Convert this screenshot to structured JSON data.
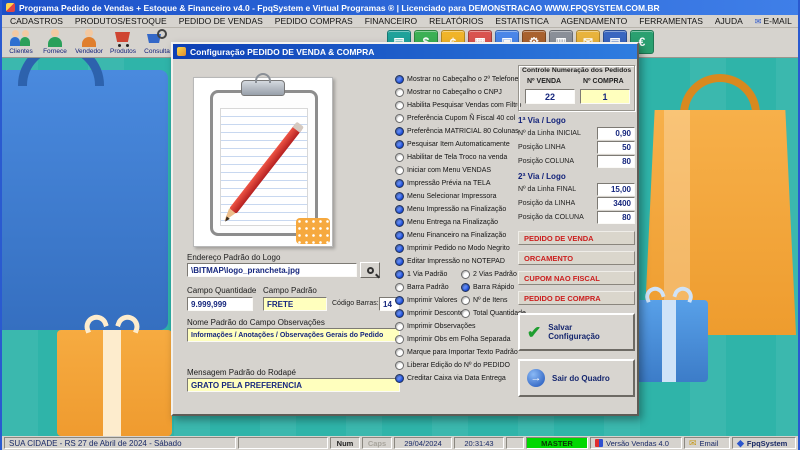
{
  "colors": {
    "titlebar": "#2160d4",
    "teal_background": "#2fb4a9",
    "accent_red": "#cc1f1f",
    "selected_blue": "#1645cf",
    "field_yellow": "#ffffbe",
    "status_green": "#00d800",
    "bag_orange": "#f5a93c",
    "bag_blue": "#3e7fd0"
  },
  "icons": {
    "email_glyph": "✉",
    "brand_glyph": "◆",
    "check_glyph": "✔",
    "exit_glyph": "→"
  },
  "window": {
    "title": "Programa Pedido de Vendas + Estoque & Financeiro v4.0 - FpqSystem e Virtual Programas ® | Licenciado para  DEMONSTRACAO WWW.FPQSYSTEM.COM.BR"
  },
  "menu": {
    "items": [
      "CADASTROS",
      "PRODUTOS/ESTOQUE",
      "PEDIDO DE VENDAS",
      "PEDIDO COMPRAS",
      "FINANCEIRO",
      "RELATÓRIOS",
      "ESTATISTICA",
      "AGENDAMENTO",
      "FERRAMENTAS",
      "AJUDA",
      "E-MAIL"
    ]
  },
  "toolbar": {
    "left": [
      {
        "label": "Clientes",
        "icon": "clients-icon"
      },
      {
        "label": "Fornece",
        "icon": "supplier-icon"
      },
      {
        "label": "Vendedor",
        "icon": "seller-icon"
      },
      {
        "label": "Produtos",
        "icon": "products-icon"
      },
      {
        "label": "Consulta",
        "icon": "product-search-icon"
      }
    ],
    "right": [
      {
        "icon": "cash-register-icon",
        "glyph": "▤",
        "bg": "#1fa29a"
      },
      {
        "icon": "money-icon",
        "glyph": "$",
        "bg": "#3cb054"
      },
      {
        "icon": "coins-icon",
        "glyph": "¢",
        "bg": "#f0b429"
      },
      {
        "icon": "calculator-icon",
        "glyph": "▦",
        "bg": "#d9534f"
      },
      {
        "icon": "calendar-icon",
        "glyph": "▣",
        "bg": "#4a86e8"
      },
      {
        "icon": "tools-icon",
        "glyph": "⚙",
        "bg": "#a9622e"
      },
      {
        "icon": "printer-icon",
        "glyph": "▥",
        "bg": "#8a8f98"
      },
      {
        "icon": "email-toolbar-icon",
        "glyph": "✉",
        "bg": "#e8b33c"
      },
      {
        "icon": "reports-icon",
        "glyph": "▤",
        "bg": "#3a66c0"
      },
      {
        "icon": "finance-icon",
        "glyph": "€",
        "bg": "#2aa070"
      }
    ]
  },
  "dialog": {
    "title": "Configuração PEDIDO DE VENDA & COMPRA",
    "logo_label": "Endereço Padrão do Logo",
    "logo_value": "\\BITMAP\\logo_prancheta.jpg",
    "qty_label": "Campo Quantidade",
    "qty_value": "9.999,999",
    "default_label": "Campo Padrão",
    "default_value": "FRETE",
    "barcode_label": "Código Barras:",
    "barcode_value": "14",
    "obs_label": "Nome Padrão do Campo Observações",
    "obs_value": "Informações / Anotações / Observações Gerais do Pedido",
    "footer_label": "Mensagem Padrão do Rodapé",
    "footer_value": "GRATO PELA PREFERENCIA",
    "options": [
      {
        "label": "Mostrar no Cabeçalho o 2º Telefone",
        "on": true
      },
      {
        "label": "Mostrar no Cabeçalho o CNPJ",
        "on": false
      },
      {
        "label": "Habilita Pesquisar Vendas com Filtro",
        "on": false
      },
      {
        "label": "Preferência Cupom Ñ Fiscal 40 col",
        "on": false
      },
      {
        "label": "Preferência MATRICIAL 80 Colunas",
        "on": true
      },
      {
        "label": "Pesquisar Item Automaticamente",
        "on": true
      },
      {
        "label": "Habilitar de Tela Troco na venda",
        "on": false
      },
      {
        "label": "Iniciar com Menu VENDAS",
        "on": false
      },
      {
        "label": "Impressão Prévia na TELA",
        "on": true
      },
      {
        "label": "Menu Selecionar Impressora",
        "on": true
      },
      {
        "label": "Menu Impressão na Finalização",
        "on": true
      },
      {
        "label": "Menu Entrega na Finalização",
        "on": true
      },
      {
        "label": "Menu Financeiro na Finalização",
        "on": true
      },
      {
        "label": "Imprimir Pedido no Modo Negrito",
        "on": true
      },
      {
        "label": "Editar Impressão no NOTEPAD",
        "on": true
      },
      {
        "label": "1 Via Padrão",
        "on": true
      },
      {
        "label": "2 Vias Padrão",
        "on": false
      },
      {
        "label": "Barra Padrão",
        "on": false
      },
      {
        "label": "Barra Rápido",
        "on": true
      },
      {
        "label": "Imprimir Valores",
        "on": true
      },
      {
        "label": "Nº de Itens",
        "on": false
      },
      {
        "label": "Imprimir Descontos",
        "on": true
      },
      {
        "label": "Total Quantidade",
        "on": false
      },
      {
        "label": "Imprimir Observações",
        "on": false
      },
      {
        "label": "Imprimir Obs em Folha Separada",
        "on": false
      },
      {
        "label": "Marque para Importar Texto Padrão",
        "on": false
      },
      {
        "label": "Liberar Edição do Nº do PEDIDO",
        "on": false
      },
      {
        "label": "Creditar Caixa via Data Entrega",
        "on": true
      }
    ],
    "numbering": {
      "title": "Controle Numeração dos Pedidos",
      "venda_label": "Nº VENDA",
      "compra_label": "Nº COMPRA",
      "venda_value": "22",
      "compra_value": "1"
    },
    "via1": {
      "title": "1ª Via / Logo",
      "rows": [
        {
          "label": "Nº da Linha INICIAL",
          "value": "0,90"
        },
        {
          "label": "Posição LINHA",
          "value": "50"
        },
        {
          "label": "Posição COLUNA",
          "value": "80"
        }
      ]
    },
    "via2": {
      "title": "2ª Via / Logo",
      "rows": [
        {
          "label": "Nº da Linha FINAL",
          "value": "15,00"
        },
        {
          "label": "Posição da LINHA",
          "value": "3400"
        },
        {
          "label": "Posição da COLUNA",
          "value": "80"
        }
      ]
    },
    "doc_buttons": [
      "PEDIDO DE VENDA",
      "ORCAMENTO",
      "CUPOM NAO FISCAL",
      "PEDIDO DE COMPRA"
    ],
    "save_label": "Salvar Configuração",
    "exit_label": "Sair do Quadro"
  },
  "status": {
    "location": "SUA CIDADE - RS 27 de Abril de 2024 - Sábado",
    "num": "Num",
    "caps": "Caps",
    "date": "29/04/2024",
    "time": "20:31:43",
    "user": "MASTER",
    "version": "Versão Vendas 4.0",
    "email": "Email",
    "brand": "FpqSystem"
  }
}
